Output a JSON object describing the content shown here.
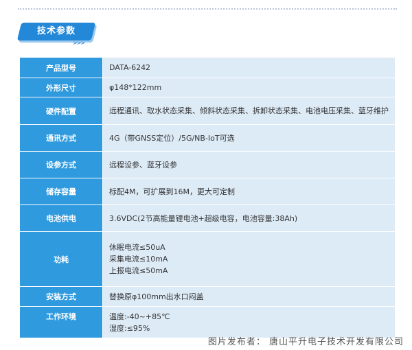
{
  "section": {
    "title": "技术参数"
  },
  "specs": [
    {
      "label": "产品型号",
      "lines": [
        "DATA-6242"
      ]
    },
    {
      "label": "外形尺寸",
      "lines": [
        "φ148*122mm"
      ]
    },
    {
      "label": "硬件配置",
      "lines": [
        "远程通讯、取水状态采集、倾斜状态采集、拆卸状态采集、电池电压采集、蓝牙维护"
      ]
    },
    {
      "label": "通讯方式",
      "lines": [
        "4G（带GNSS定位）/5G/NB-IoT可选"
      ]
    },
    {
      "label": "设参方式",
      "lines": [
        "远程设参、蓝牙设参"
      ]
    },
    {
      "label": "储存容量",
      "lines": [
        "标配4M，可扩展到16M，更大可定制"
      ]
    },
    {
      "label": "电池供电",
      "lines": [
        "3.6VDC(2节高能量锂电池+超级电容，电池容量:38Ah)"
      ]
    },
    {
      "label": "功耗",
      "lines": [
        "休眠电流≤50uA",
        "采集电流≤10mA",
        "上报电流≤50mA"
      ]
    },
    {
      "label": "安装方式",
      "lines": [
        "替换原φ100mm出水口闷盖"
      ]
    },
    {
      "label": "工作环境",
      "lines": [
        "温度:-40~+85℃",
        "湿度:≤95%"
      ]
    }
  ],
  "caption": "图片发布者：  唐山平升电子技术开发有限公司",
  "colors": {
    "header_blue": "#2488d8",
    "label_blue": "#2f9ade",
    "value_bg": "#ddebf7"
  }
}
